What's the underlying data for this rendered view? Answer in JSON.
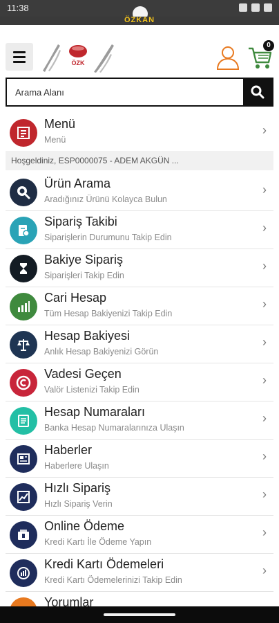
{
  "status": {
    "time": "11:38"
  },
  "brand": {
    "name": "ÖZKAN"
  },
  "header": {
    "cart_count": "0"
  },
  "search": {
    "placeholder": "Arama Alanı"
  },
  "menu_row": {
    "title": "Menü",
    "subtitle": "Menü",
    "color": "#c0272d"
  },
  "welcome": "Hoşgeldiniz, ESP0000075 - ADEM AKGÜN ...",
  "items": [
    {
      "title": "Ürün Arama",
      "subtitle": "Aradığınız Ürünü Kolayca Bulun",
      "color": "#1f2d44",
      "icon": "magnifier-icon"
    },
    {
      "title": "Sipariş Takibi",
      "subtitle": "Siparişlerin Durumunu Takip Edin",
      "color": "#2aa3b6",
      "icon": "clipboard-icon"
    },
    {
      "title": "Bakiye Sipariş",
      "subtitle": "Siparişleri Takip Edin",
      "color": "#141c24",
      "icon": "hourglass-icon"
    },
    {
      "title": "Cari Hesap",
      "subtitle": "Tüm Hesap Bakiyenizi Takip Edin",
      "color": "#3f8a3e",
      "icon": "bar-chart-icon"
    },
    {
      "title": "Hesap Bakiyesi",
      "subtitle": "Anlık Hesap Bakiyenizi Görün",
      "color": "#1f3553",
      "icon": "scale-icon"
    },
    {
      "title": "Vadesi Geçen",
      "subtitle": "Valör Listenizi Takip Edin",
      "color": "#c8253a",
      "icon": "circle-c-icon"
    },
    {
      "title": "Hesap Numaraları",
      "subtitle": "Banka Hesap Numaralarınıza Ulaşın",
      "color": "#23bfa5",
      "icon": "document-icon"
    },
    {
      "title": "Haberler",
      "subtitle": "Haberlere Ulaşın",
      "color": "#1f2d5c",
      "icon": "newspaper-icon"
    },
    {
      "title": "Hızlı Sipariş",
      "subtitle": "Hızlı Sipariş Verin",
      "color": "#1f2d5c",
      "icon": "chart-screen-icon"
    },
    {
      "title": "Online Ödeme",
      "subtitle": "Kredi Kartı İle Ödeme Yapın",
      "color": "#1f2d5c",
      "icon": "wallet-icon"
    },
    {
      "title": "Kredi Kartı Ödemeleri",
      "subtitle": "Kredi Kartı Ödemelerinizi Takip Edin",
      "color": "#1f2d5c",
      "icon": "card-report-icon"
    },
    {
      "title": "Yorumlar",
      "subtitle": "",
      "color": "#e8791f",
      "icon": "comment-icon"
    }
  ]
}
